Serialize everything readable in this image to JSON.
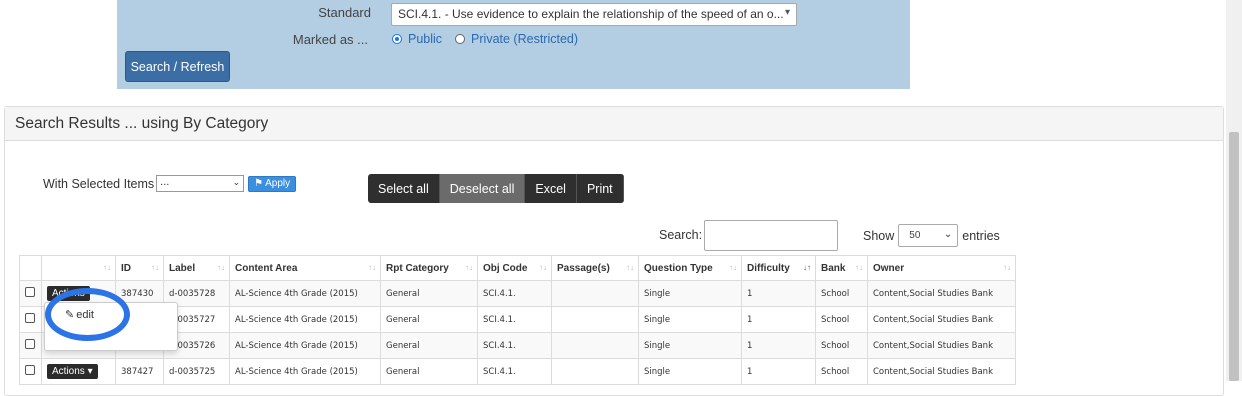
{
  "search_form": {
    "standard_label": "Standard",
    "standard_value": "SCI.4.1. - Use evidence to explain the relationship of the speed of an o...",
    "marked_label": "Marked as ...",
    "radio_public": "Public",
    "radio_private": "Private (Restricted)",
    "search_button": "Search / Refresh"
  },
  "results": {
    "title": "Search Results ... using By Category",
    "with_selected_label": "With Selected Items",
    "with_selected_value": "...",
    "apply_label": "Apply",
    "buttons": [
      "Select all",
      "Deselect all",
      "Excel",
      "Print"
    ],
    "search_label": "Search:",
    "show_label": "Show",
    "show_value": "50",
    "entries_label": "entries",
    "columns": [
      "",
      "",
      "ID",
      "Label",
      "Content Area",
      "Rpt Category",
      "Obj Code",
      "Passage(s)",
      "Question Type",
      "Difficulty",
      "Bank",
      "Owner"
    ],
    "rows": [
      {
        "action": "Actions",
        "id": "387430",
        "label": "d-0035728",
        "content_area": "AL-Science 4th Grade (2015)",
        "rpt_category": "General",
        "obj_code": "SCI.4.1.",
        "passages": "",
        "question_type": "Single",
        "difficulty": "1",
        "bank": "School",
        "owner": "Content,Social Studies Bank"
      },
      {
        "action": "",
        "id": "",
        "label": "d-0035727",
        "content_area": "AL-Science 4th Grade (2015)",
        "rpt_category": "General",
        "obj_code": "SCI.4.1.",
        "passages": "",
        "question_type": "Single",
        "difficulty": "1",
        "bank": "School",
        "owner": "Content,Social Studies Bank"
      },
      {
        "action": "",
        "id": "",
        "label": "d-0035726",
        "content_area": "AL-Science 4th Grade (2015)",
        "rpt_category": "General",
        "obj_code": "SCI.4.1.",
        "passages": "",
        "question_type": "Single",
        "difficulty": "1",
        "bank": "School",
        "owner": "Content,Social Studies Bank"
      },
      {
        "action": "Actions",
        "id": "387427",
        "label": "d-0035725",
        "content_area": "AL-Science 4th Grade (2015)",
        "rpt_category": "General",
        "obj_code": "SCI.4.1.",
        "passages": "",
        "question_type": "Single",
        "difficulty": "1",
        "bank": "School",
        "owner": "Content,Social Studies Bank"
      }
    ],
    "dropdown_edit": "edit"
  },
  "colors": {
    "panel_bg": "#b3cde3",
    "primary_button": "#3a6ea5",
    "highlight_ring": "#2b73e6"
  }
}
